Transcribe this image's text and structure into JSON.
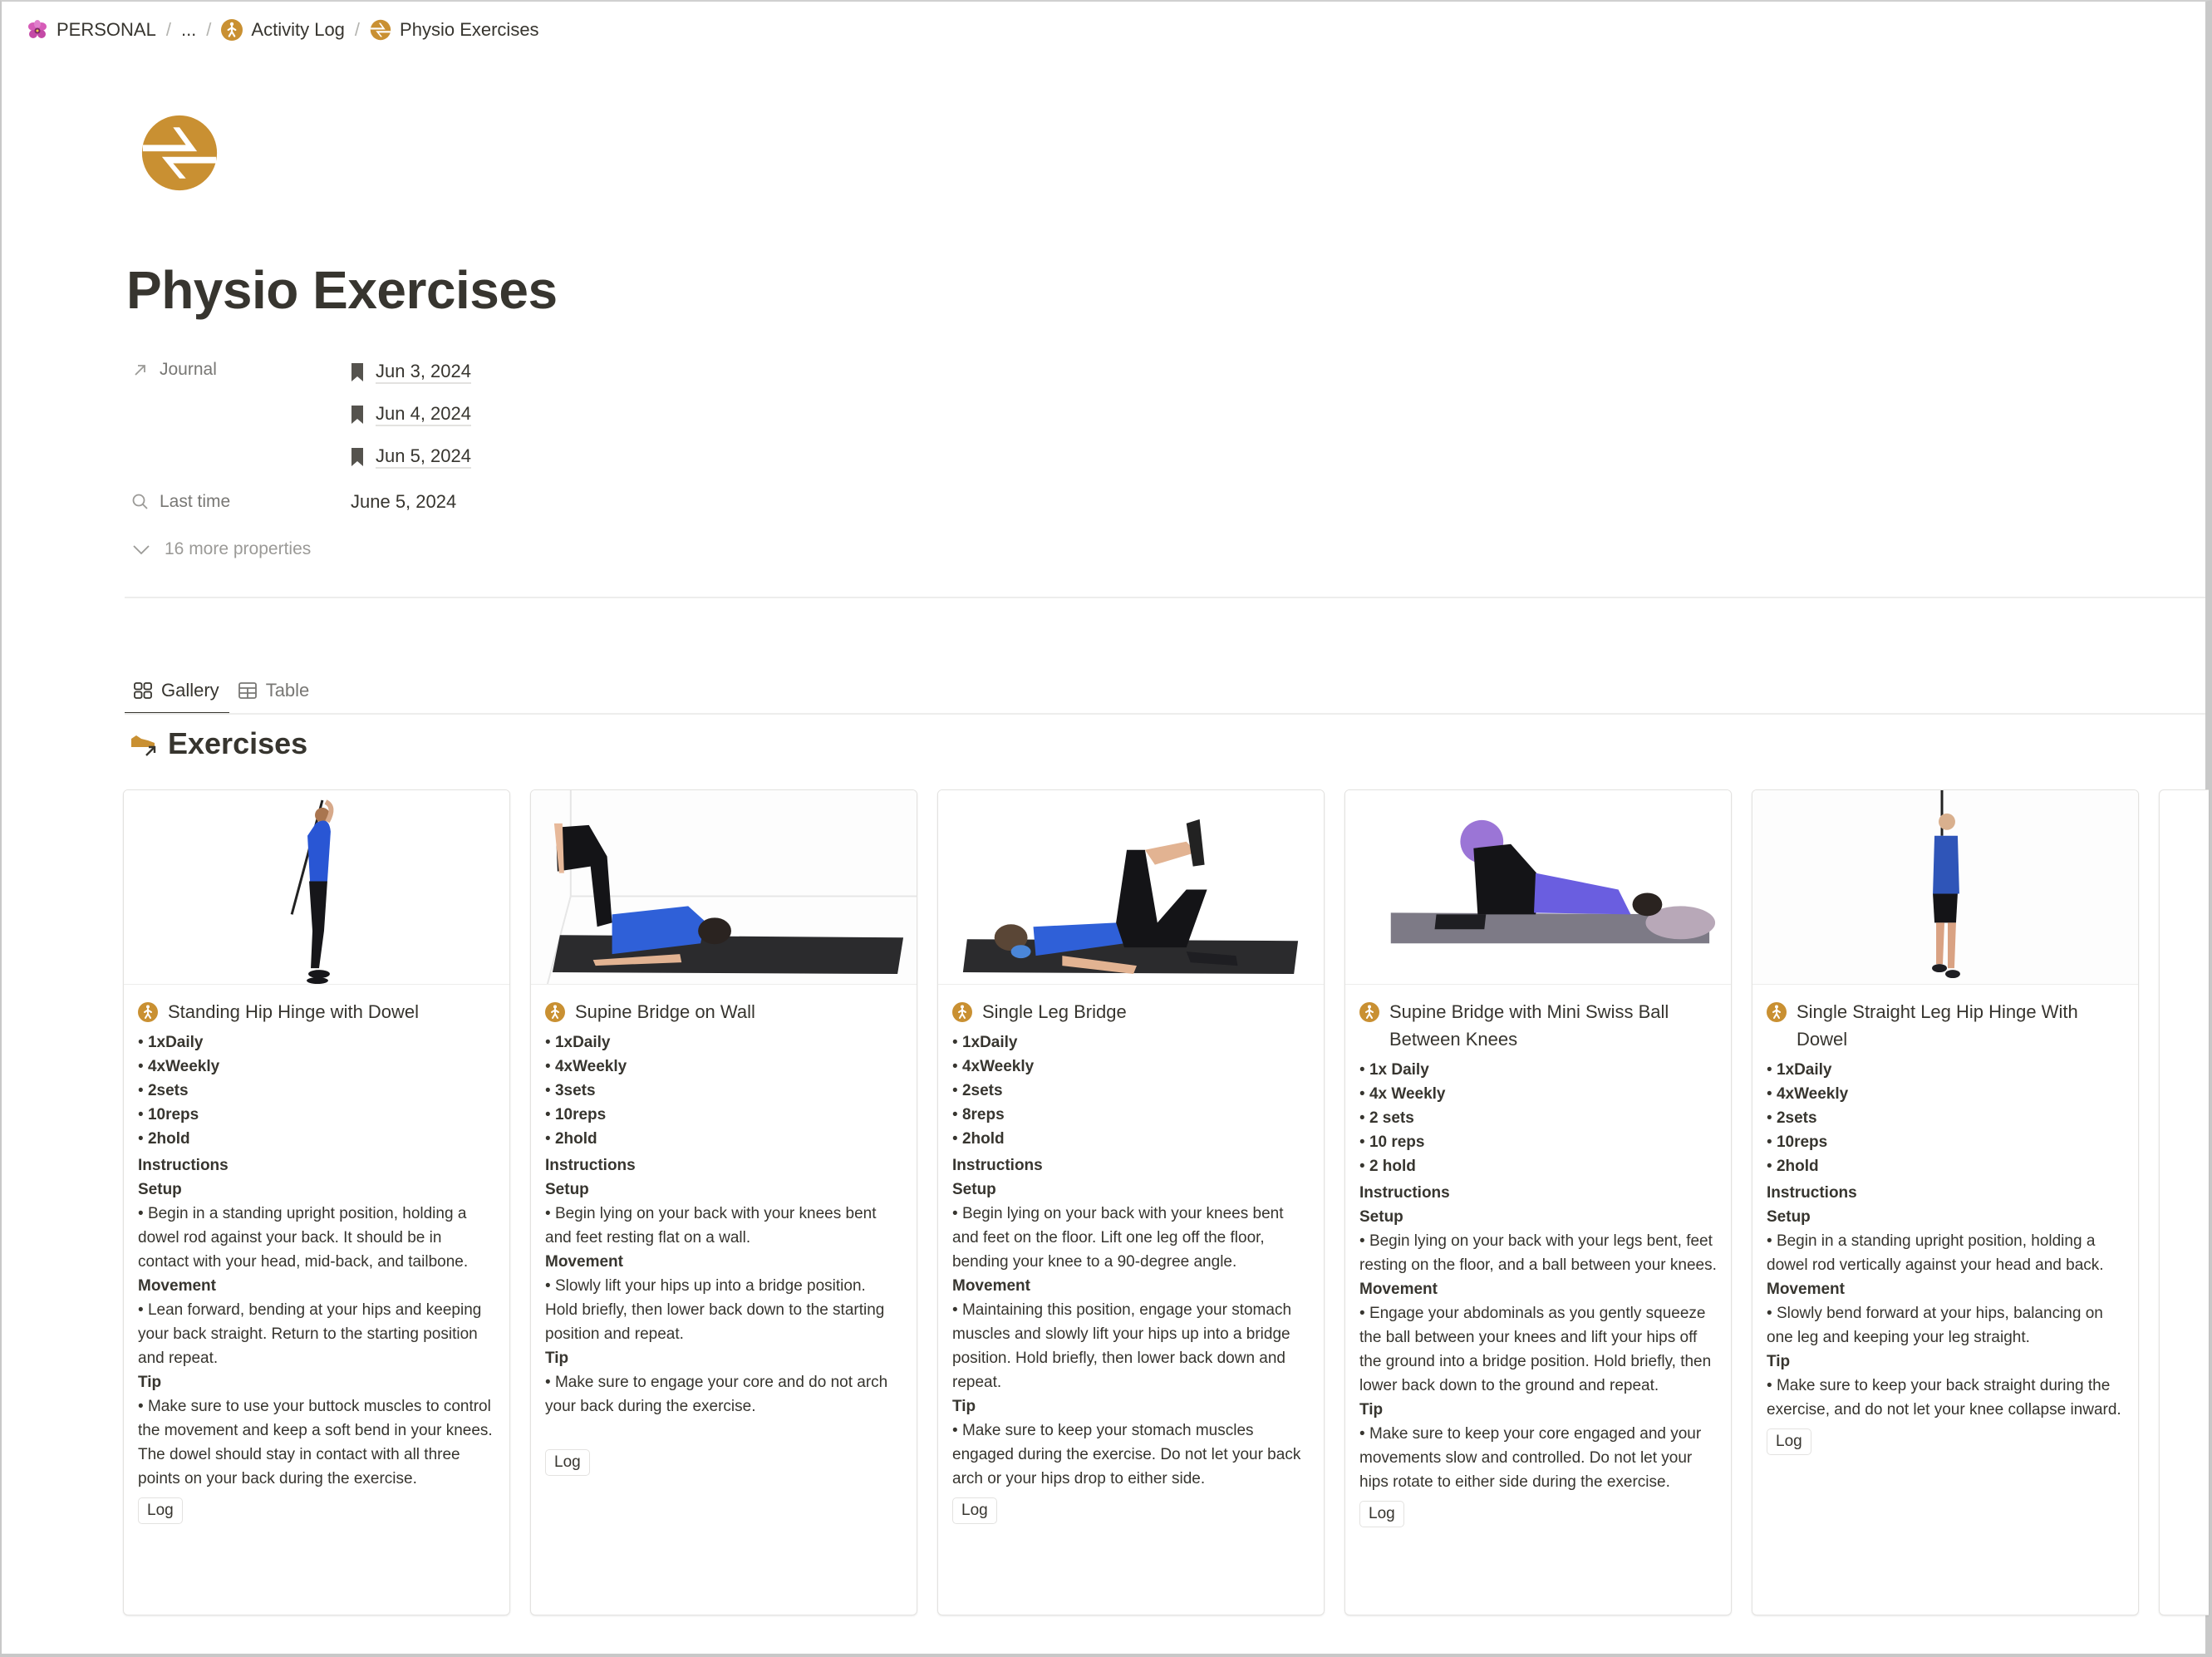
{
  "breadcrumb": {
    "items": [
      {
        "label": "PERSONAL",
        "icon": "orchid-icon"
      },
      {
        "label": "...",
        "icon": null
      },
      {
        "label": "Activity Log",
        "icon": "walking-person-icon"
      },
      {
        "label": "Physio Exercises",
        "icon": "swap-arrows-icon"
      }
    ],
    "separator": "/"
  },
  "page": {
    "icon": "swap-arrows-icon",
    "title": "Physio Exercises",
    "accent_color": "#c99032"
  },
  "properties": {
    "journal": {
      "label": "Journal",
      "icon": "arrow-up-right-icon",
      "values": [
        "Jun 3, 2024",
        "Jun 4, 2024",
        "Jun 5, 2024"
      ]
    },
    "last_time": {
      "label": "Last time",
      "icon": "search-icon",
      "value": "June 5, 2024"
    },
    "more": "16 more properties"
  },
  "tabs": [
    {
      "label": "Gallery",
      "icon": "gallery-grid-icon",
      "active": true
    },
    {
      "label": "Table",
      "icon": "table-icon",
      "active": false
    }
  ],
  "section": {
    "title": "Exercises",
    "icon": "shoe-link-icon"
  },
  "cards": [
    {
      "title": "Standing Hip Hinge with Dowel",
      "image": "standing-hip-hinge-photo",
      "stats": [
        "1xDaily",
        "4xWeekly",
        "2sets",
        "10reps",
        "2hold"
      ],
      "instructions_label": "Instructions",
      "setup_label": "Setup",
      "setup": "Begin in a standing upright position, holding a dowel rod against your back. It should be in contact with your head, mid-back, and tailbone.",
      "movement_label": "Movement",
      "movement": "Lean forward, bending at your hips and keeping your back straight. Return to the starting position and repeat.",
      "tip_label": "Tip",
      "tip": "Make sure to use your buttock muscles to control the movement and keep a soft bend in your knees. The dowel should stay in contact with all three points on your back during the exercise.",
      "log_label": "Log"
    },
    {
      "title": "Supine Bridge on Wall",
      "image": "supine-bridge-wall-photo",
      "stats": [
        "1xDaily",
        "4xWeekly",
        "3sets",
        "10reps",
        "2hold"
      ],
      "instructions_label": "Instructions",
      "setup_label": "Setup",
      "setup": "Begin lying on your back with your knees bent and feet resting flat on a wall.",
      "movement_label": "Movement",
      "movement": "Slowly lift your hips up into a bridge position. Hold briefly, then lower back down to the starting position and repeat.",
      "tip_label": "Tip",
      "tip": "Make sure to engage your core and do not arch your back during the exercise.",
      "log_label": "Log"
    },
    {
      "title": "Single Leg Bridge",
      "image": "single-leg-bridge-photo",
      "stats": [
        "1xDaily",
        "4xWeekly",
        "2sets",
        "8reps",
        "2hold"
      ],
      "instructions_label": "Instructions",
      "setup_label": "Setup",
      "setup": "Begin lying on your back with your knees bent and feet on the floor. Lift one leg off the floor, bending your knee to a 90-degree angle.",
      "movement_label": "Movement",
      "movement": "Maintaining this position, engage your stomach muscles and slowly lift your hips up into a bridge position. Hold briefly, then lower back down and repeat.",
      "tip_label": "Tip",
      "tip": "Make sure to keep your stomach muscles engaged during the exercise. Do not let your back arch or your hips drop to either side.",
      "log_label": "Log"
    },
    {
      "title": "Supine Bridge with Mini Swiss Ball Between Knees",
      "image": "supine-bridge-swiss-ball-photo",
      "stats": [
        "1x Daily",
        "4x Weekly",
        "2 sets",
        "10 reps",
        "2 hold"
      ],
      "instructions_label": "Instructions",
      "setup_label": "Setup",
      "setup": "Begin lying on your back with your legs bent, feet resting on the floor, and a ball between your knees.",
      "movement_label": "Movement",
      "movement": "Engage your abdominals as you gently squeeze the ball between your knees and lift your hips off the ground into a bridge position. Hold briefly, then lower back down to the ground and repeat.",
      "tip_label": "Tip",
      "tip": "Make sure to keep your core engaged and your movements slow and controlled. Do not let your hips rotate to either side during the exercise.",
      "log_label": "Log"
    },
    {
      "title": "Single Straight Leg Hip Hinge With Dowel",
      "image": "single-leg-hip-hinge-photo",
      "stats": [
        "1xDaily",
        "4xWeekly",
        "2sets",
        "10reps",
        "2hold"
      ],
      "instructions_label": "Instructions",
      "setup_label": "Setup",
      "setup": "Begin in a standing upright position, holding a dowel rod vertically against your head and back.",
      "movement_label": "Movement",
      "movement": "Slowly bend forward at your hips, balancing on one leg and keeping your leg straight.",
      "tip_label": "Tip",
      "tip": "Make sure to keep your back straight during the exercise, and do not let your knee collapse inward.",
      "log_label": "Log"
    }
  ]
}
